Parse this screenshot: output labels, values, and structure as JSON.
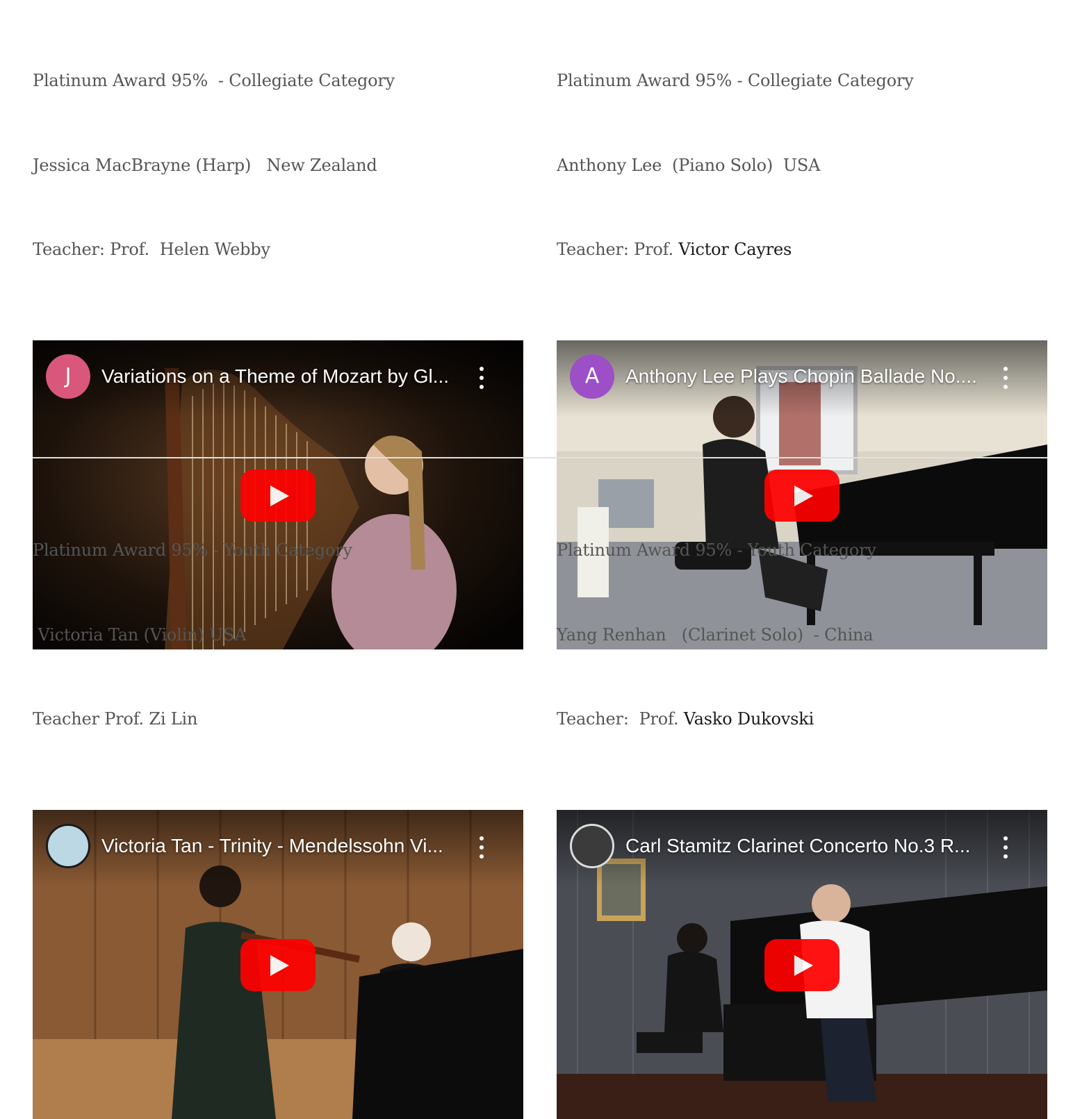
{
  "entries": [
    {
      "lines": [
        "Platinum Award 95%  - Collegiate Category",
        "Jessica MacBrayne (Harp)   New Zealand",
        "Teacher: Prof.  Helen Webby"
      ],
      "video": {
        "title": "Variations on a Theme of Mozart by Gl...",
        "avatar_letter": "J",
        "avatar_color": "#d9577a",
        "play_icon": "youtube-play-icon"
      }
    },
    {
      "lines": [
        "Platinum Award 95% - Collegiate Category",
        "Anthony Lee  (Piano Solo)  USA",
        "Teacher: Prof. ",
        "Victor Cayres"
      ],
      "video": {
        "title": "Anthony Lee Plays Chopin Ballade No....",
        "avatar_letter": "A",
        "avatar_color": "#9c4fc7",
        "play_icon": "youtube-play-icon"
      }
    },
    {
      "lines": [
        "Platinum Award 95% - Youth Category",
        " Victoria Tan (Violin) USA",
        "Teacher Prof. Zi Lin"
      ],
      "video": {
        "title": "Victoria Tan - Trinity - Mendelssohn Vi...",
        "avatar_letter": "",
        "avatar_color": "#bcd8e4",
        "play_icon": "youtube-play-icon"
      }
    },
    {
      "lines": [
        "Platinum Award 95% - Youth Category",
        "Yang Renhan   (Clarinet Solo)  - China",
        "Teacher:  Prof. ",
        "Vasko Dukovski"
      ],
      "video": {
        "title": "Carl Stamitz Clarinet Concerto No.3 R...",
        "avatar_letter": "",
        "avatar_color": "#3b3b3b",
        "play_icon": "youtube-play-icon"
      }
    }
  ]
}
